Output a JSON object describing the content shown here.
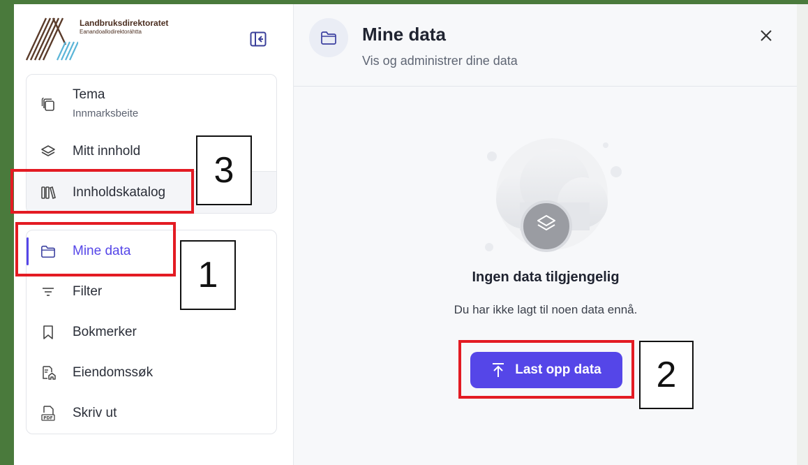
{
  "logo": {
    "title": "Landbruksdirektoratet",
    "subtitle": "Eanandoallodirektoráhtta"
  },
  "sidebar": {
    "top_items": [
      {
        "label": "Tema",
        "sublabel": "Innmarksbeite"
      },
      {
        "label": "Mitt innhold"
      },
      {
        "label": "Innholdskatalog"
      }
    ],
    "bottom_items": [
      {
        "label": "Mine data",
        "active": true
      },
      {
        "label": "Filter"
      },
      {
        "label": "Bokmerker"
      },
      {
        "label": "Eiendomssøk"
      },
      {
        "label": "Skriv ut"
      }
    ]
  },
  "panel": {
    "title": "Mine data",
    "subtitle": "Vis og administrer dine data",
    "empty_title": "Ingen data tilgjengelig",
    "empty_text": "Du har ikke lagt til noen data ennå.",
    "upload_label": "Last opp data"
  },
  "annotations": {
    "one": "1",
    "two": "2",
    "three": "3"
  },
  "colors": {
    "accent": "#5546e8",
    "highlight": "#e31b23",
    "frame": "#4a7a3c"
  },
  "icons": {
    "collapse": "sidebar-collapse-icon",
    "tema": "stack-copy-icon",
    "mitt_innhold": "layers-icon",
    "innholdskatalog": "library-books-icon",
    "mine_data": "folder-icon",
    "filter": "filter-lines-icon",
    "bokmerker": "bookmark-icon",
    "eiendomssok": "property-search-icon",
    "skriv_ut": "pdf-file-icon",
    "close": "close-icon",
    "upload": "upload-arrow-icon"
  }
}
